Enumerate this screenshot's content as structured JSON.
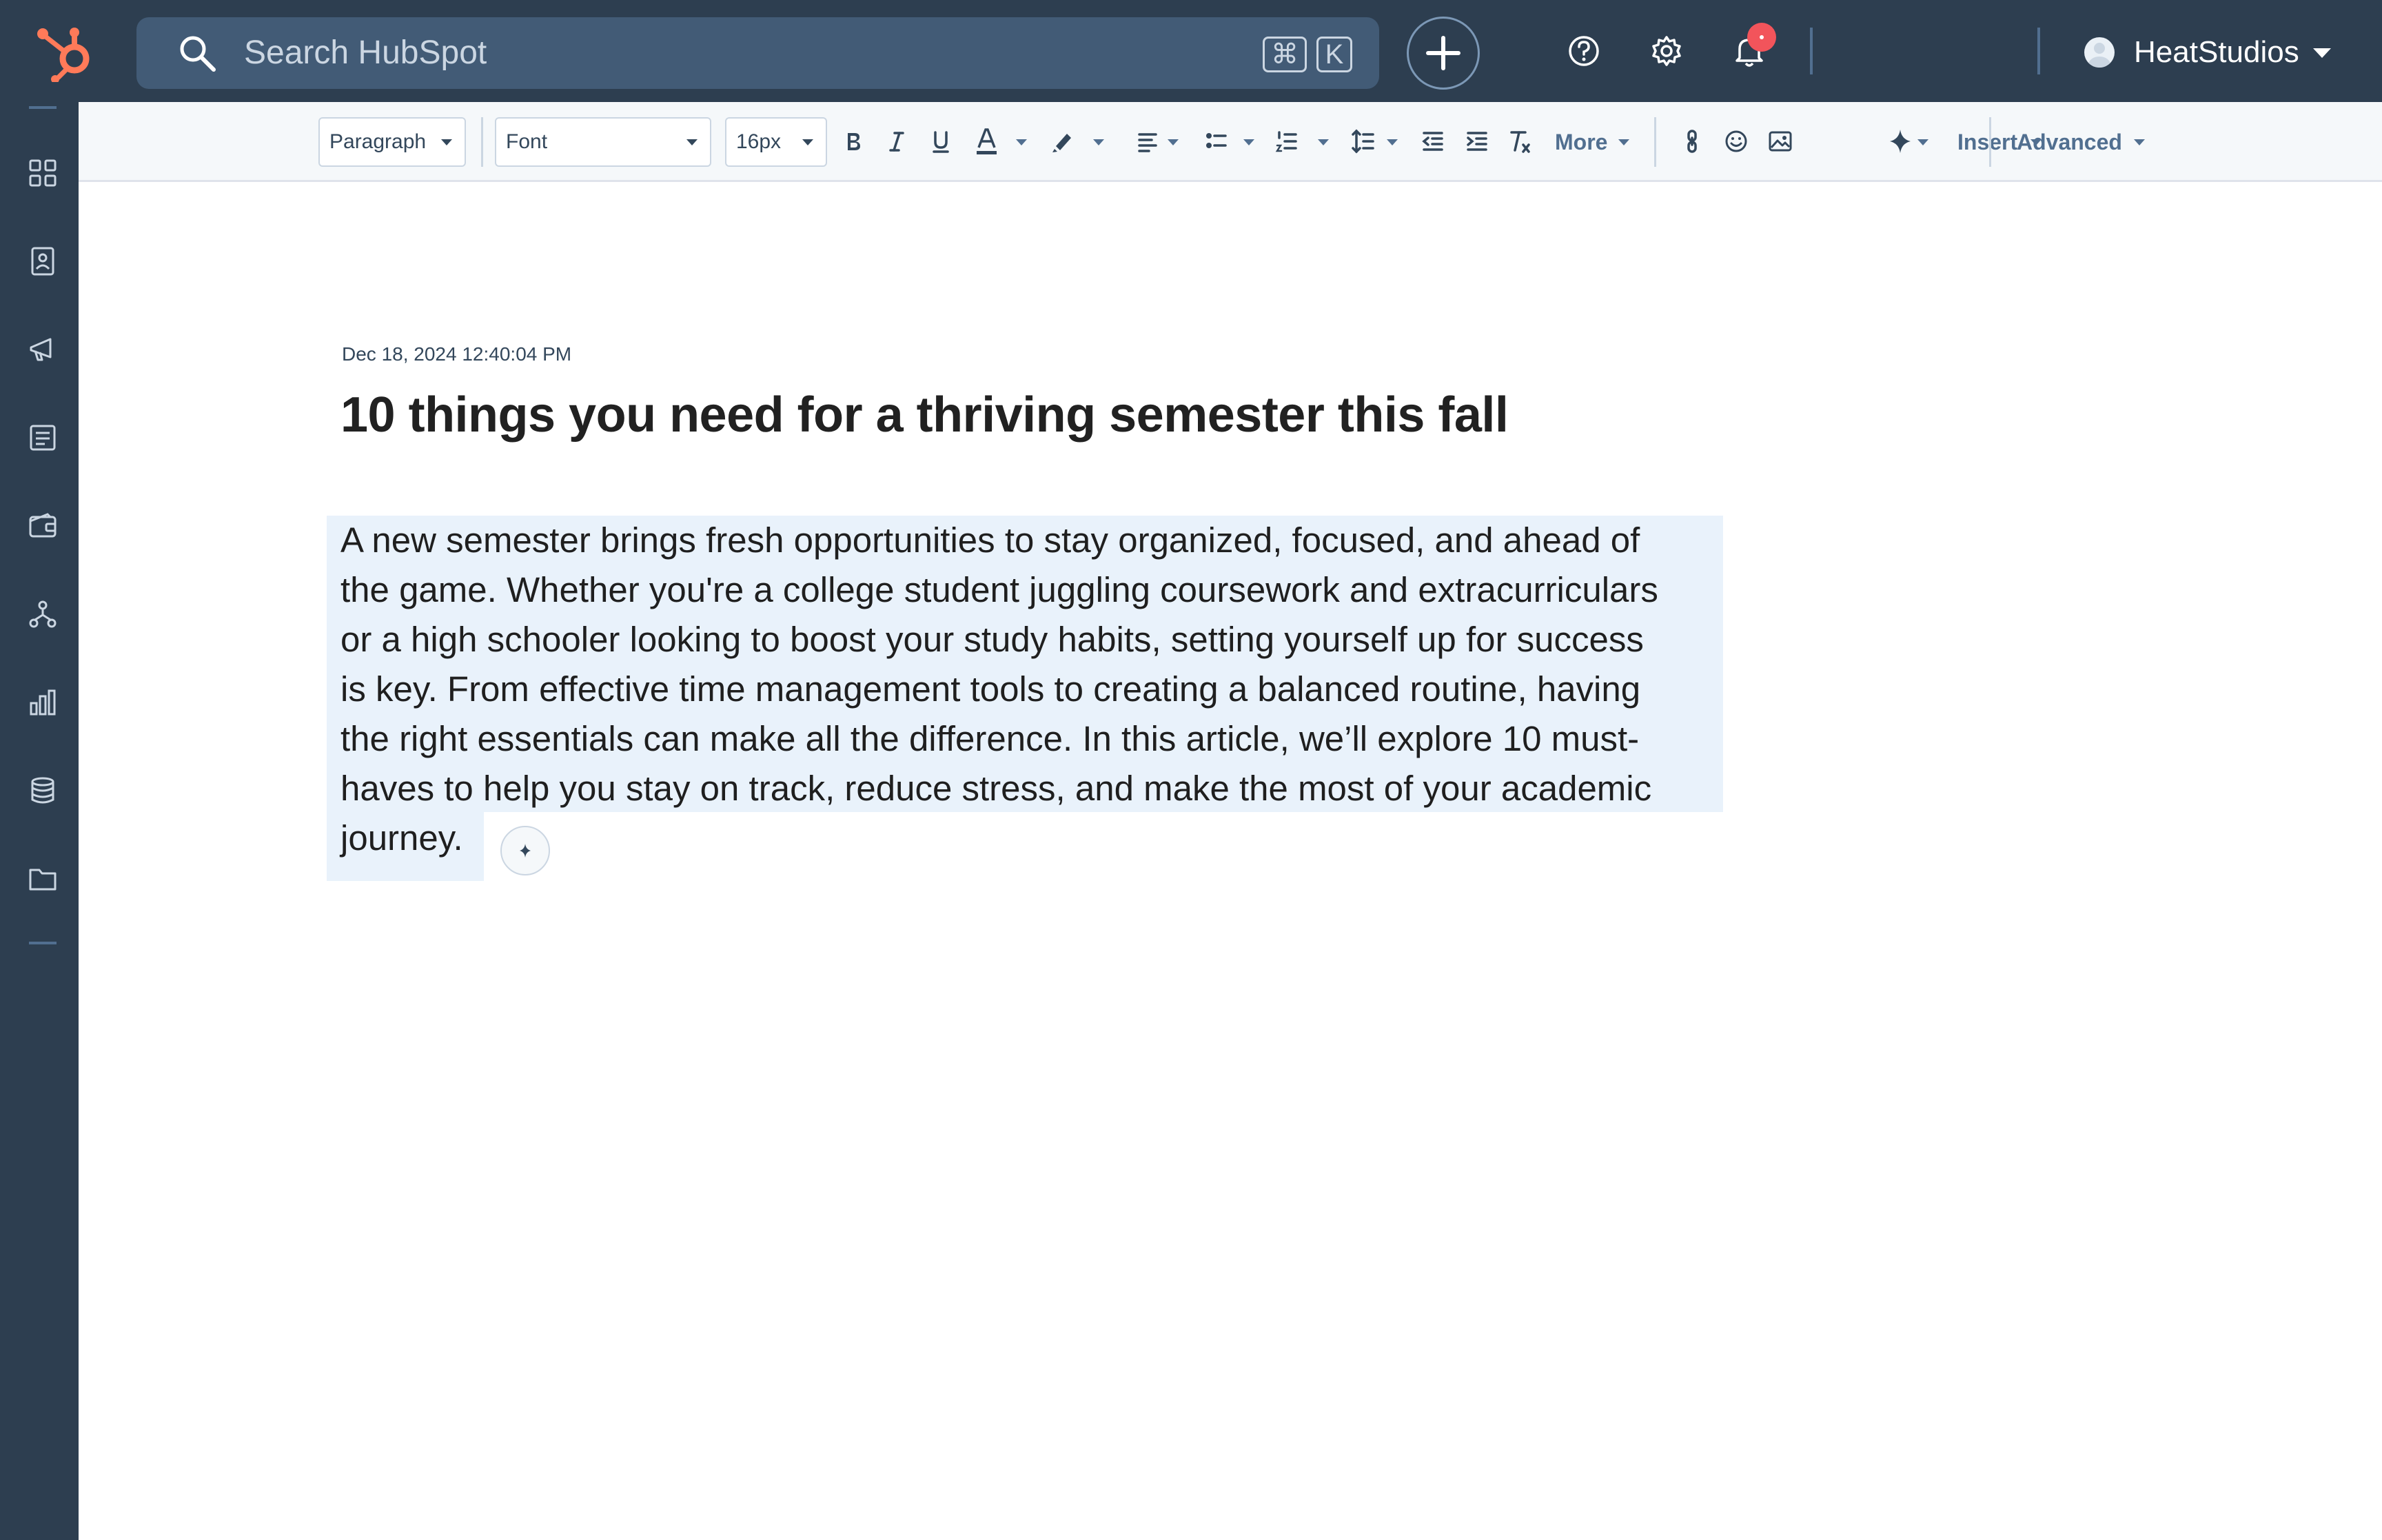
{
  "topnav": {
    "search_placeholder": "Search HubSpot",
    "shortcut_cmd": "⌘",
    "shortcut_key": "K",
    "account_name": "HeatStudios"
  },
  "toolbar": {
    "block_style": "Paragraph",
    "font": "Font",
    "font_size": "16px",
    "more_label": "More",
    "insert_label": "Insert",
    "advanced_label": "Advanced"
  },
  "document": {
    "timestamp": "Dec 18, 2024 12:40:04 PM",
    "title": "10 things you need for a thriving semester this fall",
    "body_lines": [
      "A new semester brings fresh opportunities to stay organized, focused, and ahead of",
      "the game. Whether you're a college student juggling coursework and extracurriculars",
      "or a high schooler looking to boost your study habits, setting yourself up for success",
      "is key. From effective time management tools to creating a balanced routine, having",
      "the right essentials can make all the difference. In this article, we’ll explore 10 must-",
      "haves to help you stay on track, reduce stress, and make the most of your academic",
      "journey."
    ]
  },
  "colors": {
    "nav_bg": "#2d3e50",
    "search_bg": "#425b76",
    "brand_orange": "#ff7a59",
    "notification": "#f2545b",
    "selection_bg": "#e9f2fb"
  },
  "icons": [
    "sprocket-logo",
    "search-icon",
    "plus-icon",
    "help-icon",
    "gear-icon",
    "bell-icon",
    "bookmarks-icon",
    "contacts-icon",
    "marketing-icon",
    "content-icon",
    "commerce-icon",
    "automation-icon",
    "reporting-icon",
    "data-icon",
    "library-icon",
    "ai-sparkle-icon"
  ]
}
